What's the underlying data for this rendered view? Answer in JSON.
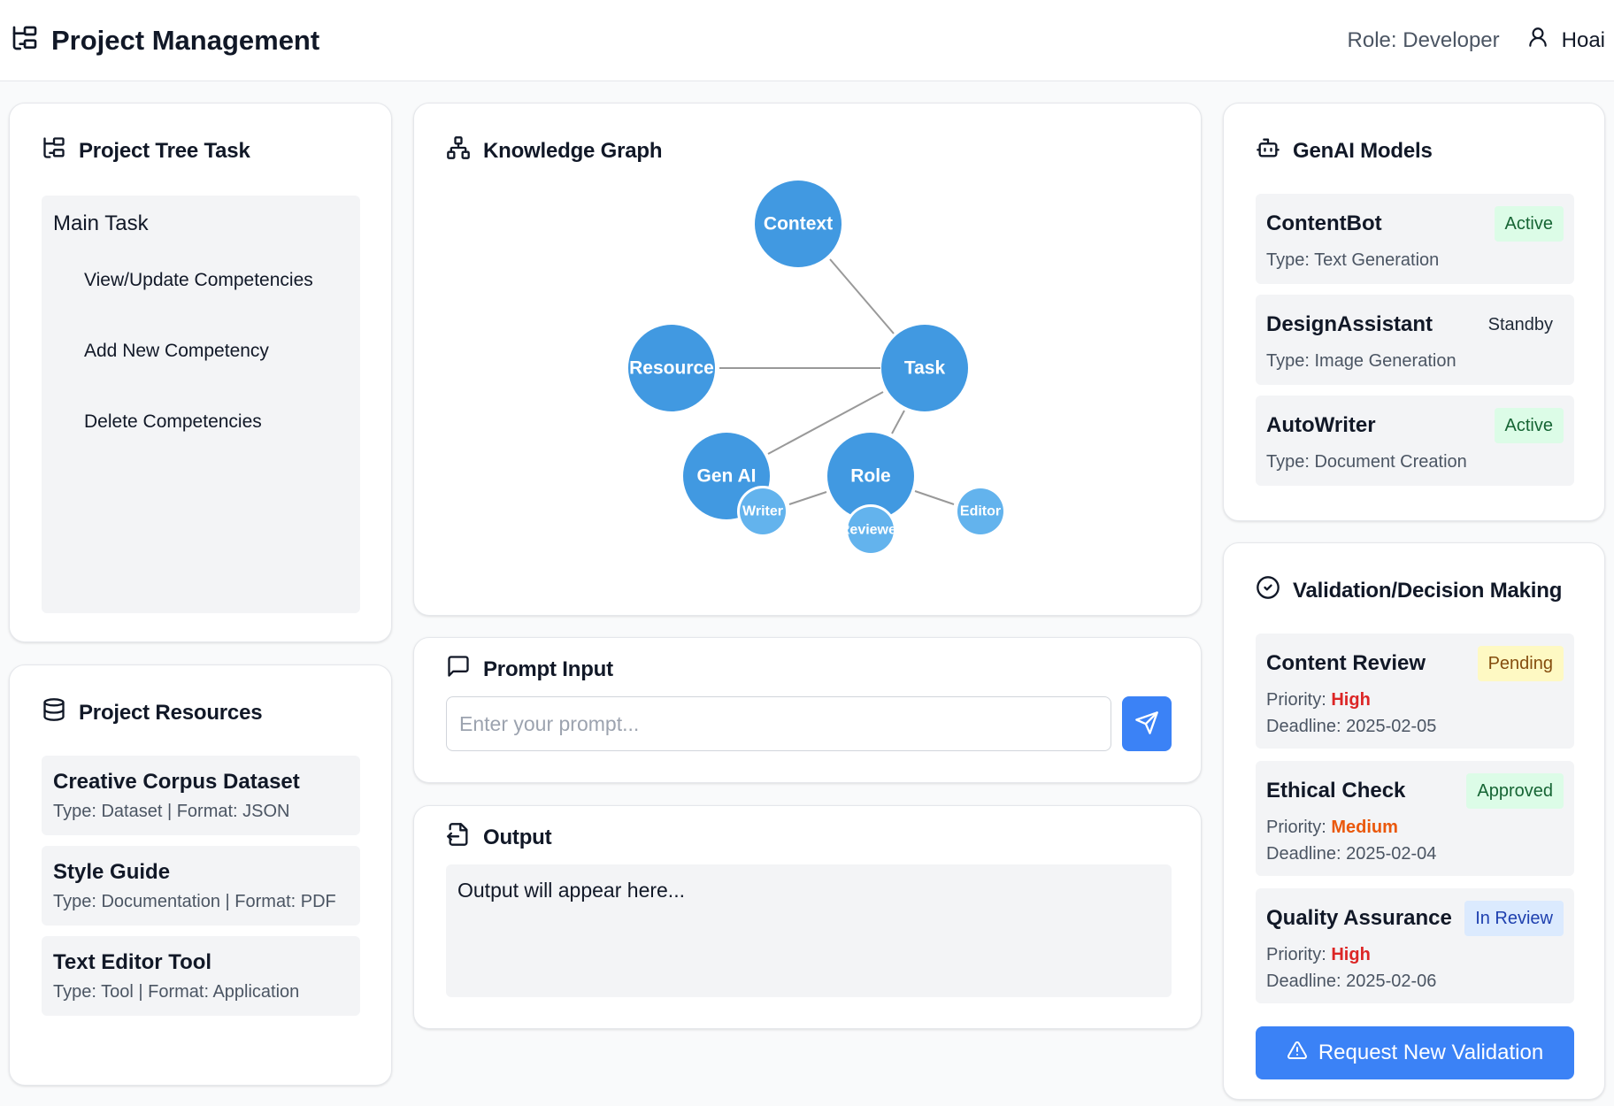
{
  "header": {
    "title": "Project Management",
    "role": "Role: Developer",
    "user": "Hoai"
  },
  "project_tree": {
    "title": "Project Tree Task",
    "main": "Main Task",
    "items": [
      "View/Update Competencies",
      "Add New Competency",
      "Delete Competencies"
    ]
  },
  "resources": {
    "title": "Project Resources",
    "items": [
      {
        "name": "Creative Corpus Dataset",
        "meta": "Type: Dataset | Format: JSON"
      },
      {
        "name": "Style Guide",
        "meta": "Type: Documentation | Format: PDF"
      },
      {
        "name": "Text Editor Tool",
        "meta": "Type: Tool | Format: Application"
      }
    ]
  },
  "knowledge_graph": {
    "title": "Knowledge Graph",
    "nodes": {
      "context": "Context",
      "resource": "Resource",
      "task": "Task",
      "genai": "Gen AI",
      "role": "Role",
      "writer": "Writer",
      "reviewer": "Reviewer",
      "editor": "Editor"
    },
    "colors": {
      "main": "#4199e1",
      "sub": "#63b3ed",
      "edge": "#999999"
    }
  },
  "prompt": {
    "title": "Prompt Input",
    "placeholder": "Enter your prompt..."
  },
  "output": {
    "title": "Output",
    "text": "Output will appear here..."
  },
  "models": {
    "title": "GenAI Models",
    "items": [
      {
        "name": "ContentBot",
        "type": "Type: Text Generation",
        "status": "Active"
      },
      {
        "name": "DesignAssistant",
        "type": "Type: Image Generation",
        "status": "Standby"
      },
      {
        "name": "AutoWriter",
        "type": "Type: Document Creation",
        "status": "Active"
      }
    ]
  },
  "validation": {
    "title": "Validation/Decision Making",
    "priority_label": "Priority:",
    "deadline_label": "Deadline:",
    "items": [
      {
        "name": "Content Review",
        "status": "Pending",
        "priority": "High",
        "deadline": "2025-02-05"
      },
      {
        "name": "Ethical Check",
        "status": "Approved",
        "priority": "Medium",
        "deadline": "2025-02-04"
      },
      {
        "name": "Quality Assurance",
        "status": "In Review",
        "priority": "High",
        "deadline": "2025-02-06"
      }
    ],
    "button": "Request New Validation"
  },
  "accent_color": "#3b82f6"
}
